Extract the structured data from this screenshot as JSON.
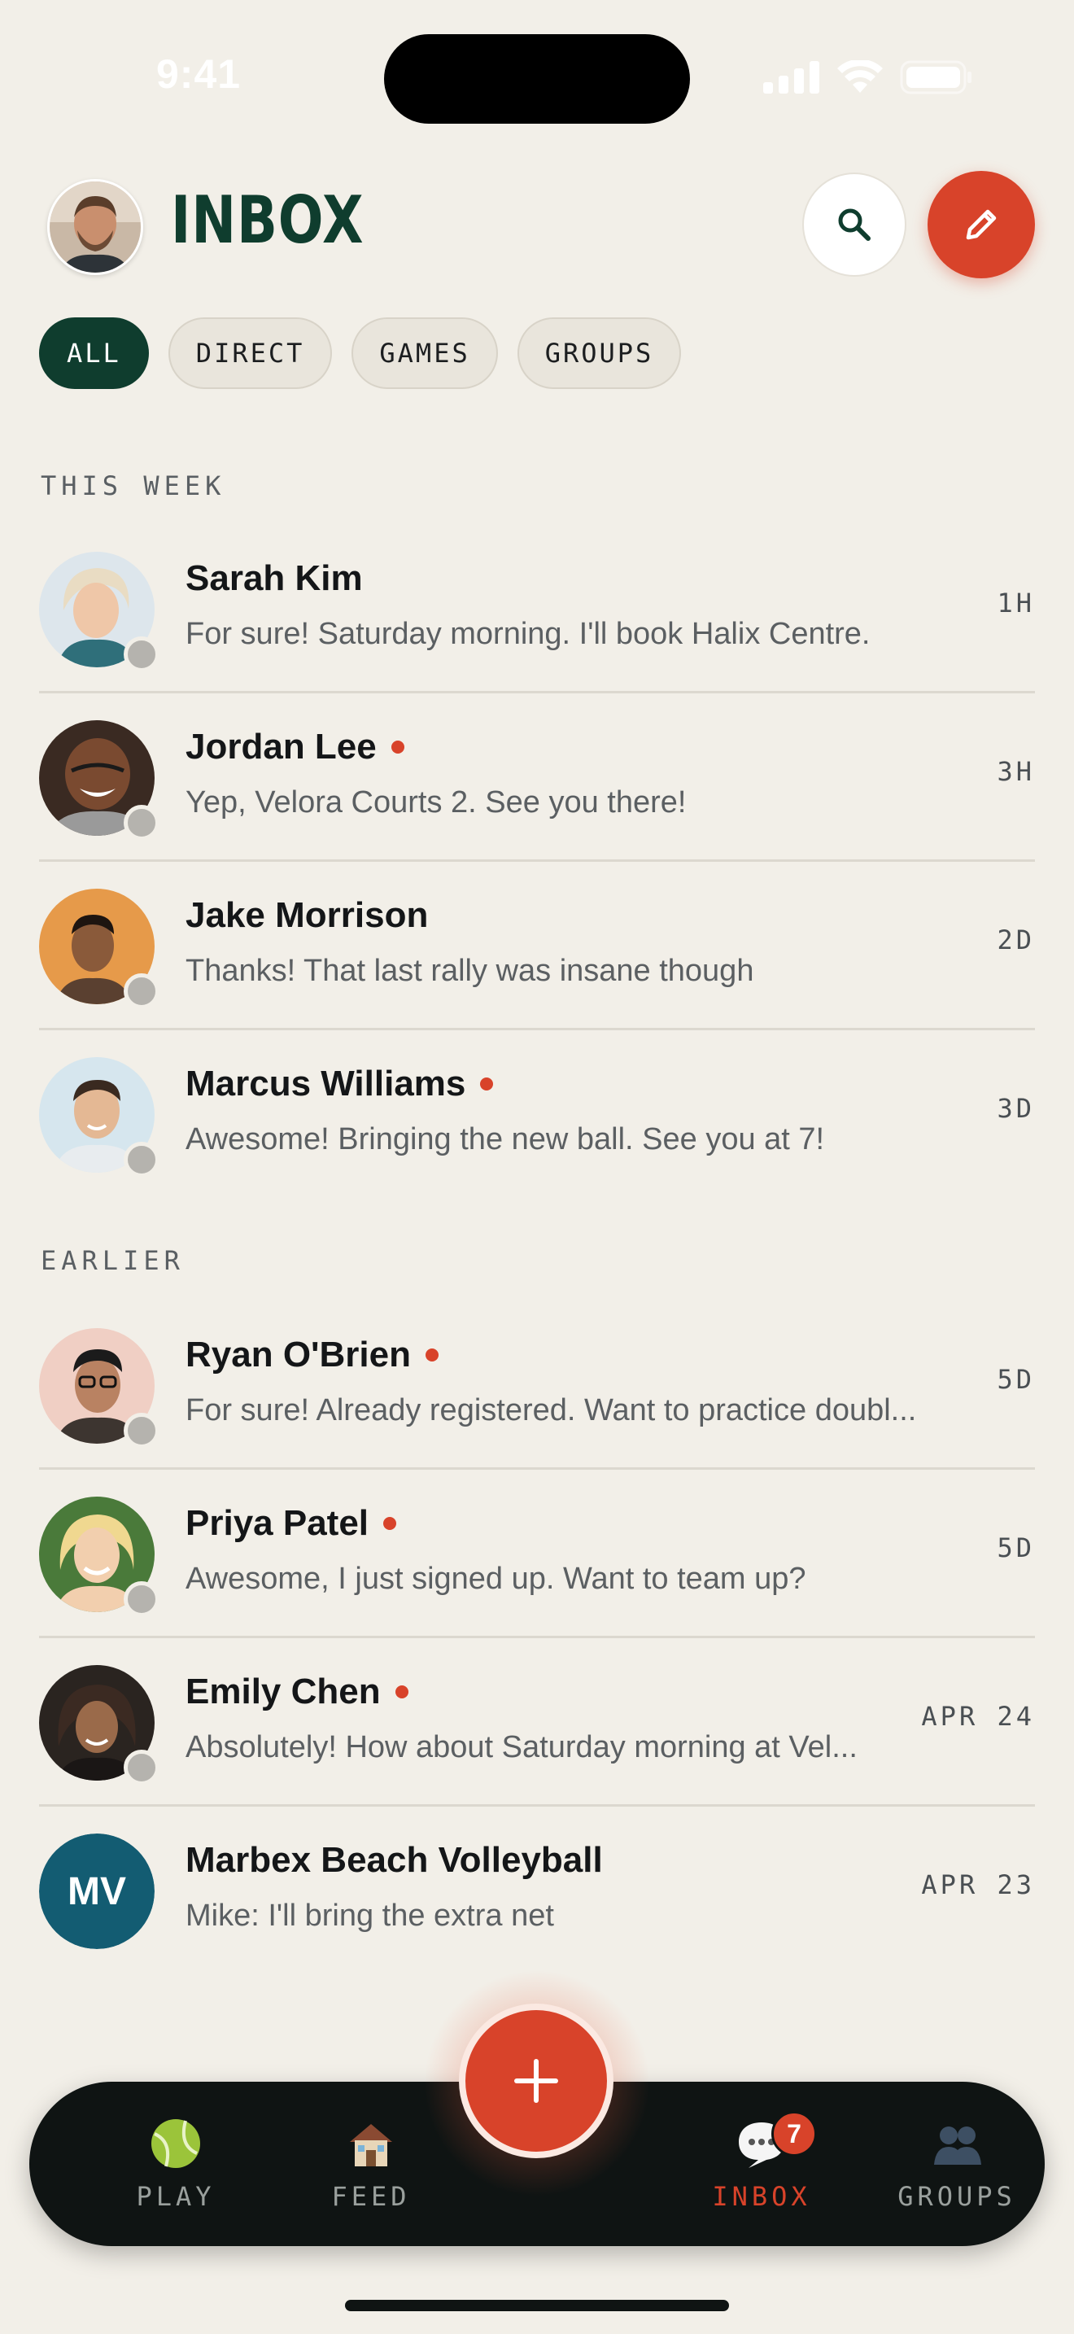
{
  "status_bar": {
    "time": "9:41"
  },
  "header": {
    "title": "INBOX",
    "avatar_icon": "profile-avatar",
    "search_icon": "search-icon",
    "compose_icon": "pencil-icon"
  },
  "filters": [
    {
      "label": "ALL",
      "active": true
    },
    {
      "label": "DIRECT",
      "active": false
    },
    {
      "label": "GAMES",
      "active": false
    },
    {
      "label": "GROUPS",
      "active": false
    }
  ],
  "sections": {
    "this_week": {
      "label": "THIS WEEK",
      "conversations": [
        {
          "name": "Sarah Kim",
          "preview": "For sure! Saturday morning. I'll book Halix Centre.",
          "time": "1H",
          "unread": false
        },
        {
          "name": "Jordan Lee",
          "preview": "Yep, Velora Courts 2. See you there!",
          "time": "3H",
          "unread": true
        },
        {
          "name": "Jake Morrison",
          "preview": "Thanks! That last rally was insane though",
          "time": "2D",
          "unread": false
        },
        {
          "name": "Marcus Williams",
          "preview": "Awesome! Bringing the new ball. See you at 7!",
          "time": "3D",
          "unread": true
        }
      ]
    },
    "earlier": {
      "label": "EARLIER",
      "conversations": [
        {
          "name": "Ryan O'Brien",
          "preview": "For sure! Already registered. Want to practice doubl...",
          "time": "5D",
          "unread": true
        },
        {
          "name": "Priya Patel",
          "preview": "Awesome, I just signed up. Want to team up?",
          "time": "5D",
          "unread": true
        },
        {
          "name": "Emily Chen",
          "preview": "Absolutely! How about Saturday morning at Vel...",
          "time": "APR 24",
          "unread": true
        },
        {
          "name": "Marbex Beach Volleyball",
          "preview": "Mike: I'll bring the extra net",
          "time": "APR 23",
          "unread": false,
          "initials": "MV"
        }
      ]
    }
  },
  "tabbar": {
    "tabs": [
      {
        "label": "PLAY",
        "icon": "tennis-ball-icon",
        "active": false
      },
      {
        "label": "FEED",
        "icon": "house-icon",
        "active": false
      },
      {
        "label": "INBOX",
        "icon": "speech-bubble-icon",
        "active": true,
        "badge": "7"
      },
      {
        "label": "GROUPS",
        "icon": "people-icon",
        "active": false
      }
    ],
    "fab_icon": "plus-icon"
  },
  "colors": {
    "accent": "#d8432a",
    "brand_green": "#0f3d2e",
    "background": "#f2efe8",
    "tabbar": "#0f1413",
    "group_avatar": "#135c72"
  }
}
